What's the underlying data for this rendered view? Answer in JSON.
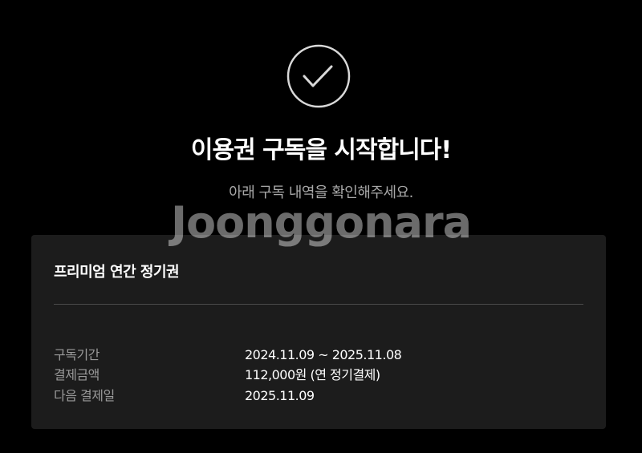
{
  "header": {
    "icon": "check-circle-icon",
    "title": "이용권 구독을 시작합니다!",
    "subtitle": "아래 구독 내역을 확인해주세요."
  },
  "watermark": "Joonggonara",
  "card": {
    "plan_name": "프리미엄 연간 정기권",
    "rows": [
      {
        "label": "구독기간",
        "value": "2024.11.09 ~ 2025.11.08"
      },
      {
        "label": "결제금액",
        "value": "112,000원 (연 정기결제)"
      },
      {
        "label": "다음 결제일",
        "value": "2025.11.09"
      }
    ]
  },
  "colors": {
    "background": "#000000",
    "card": "#1c1c1c",
    "label": "#9a9a9a",
    "subtitle": "#a8a8a8"
  }
}
